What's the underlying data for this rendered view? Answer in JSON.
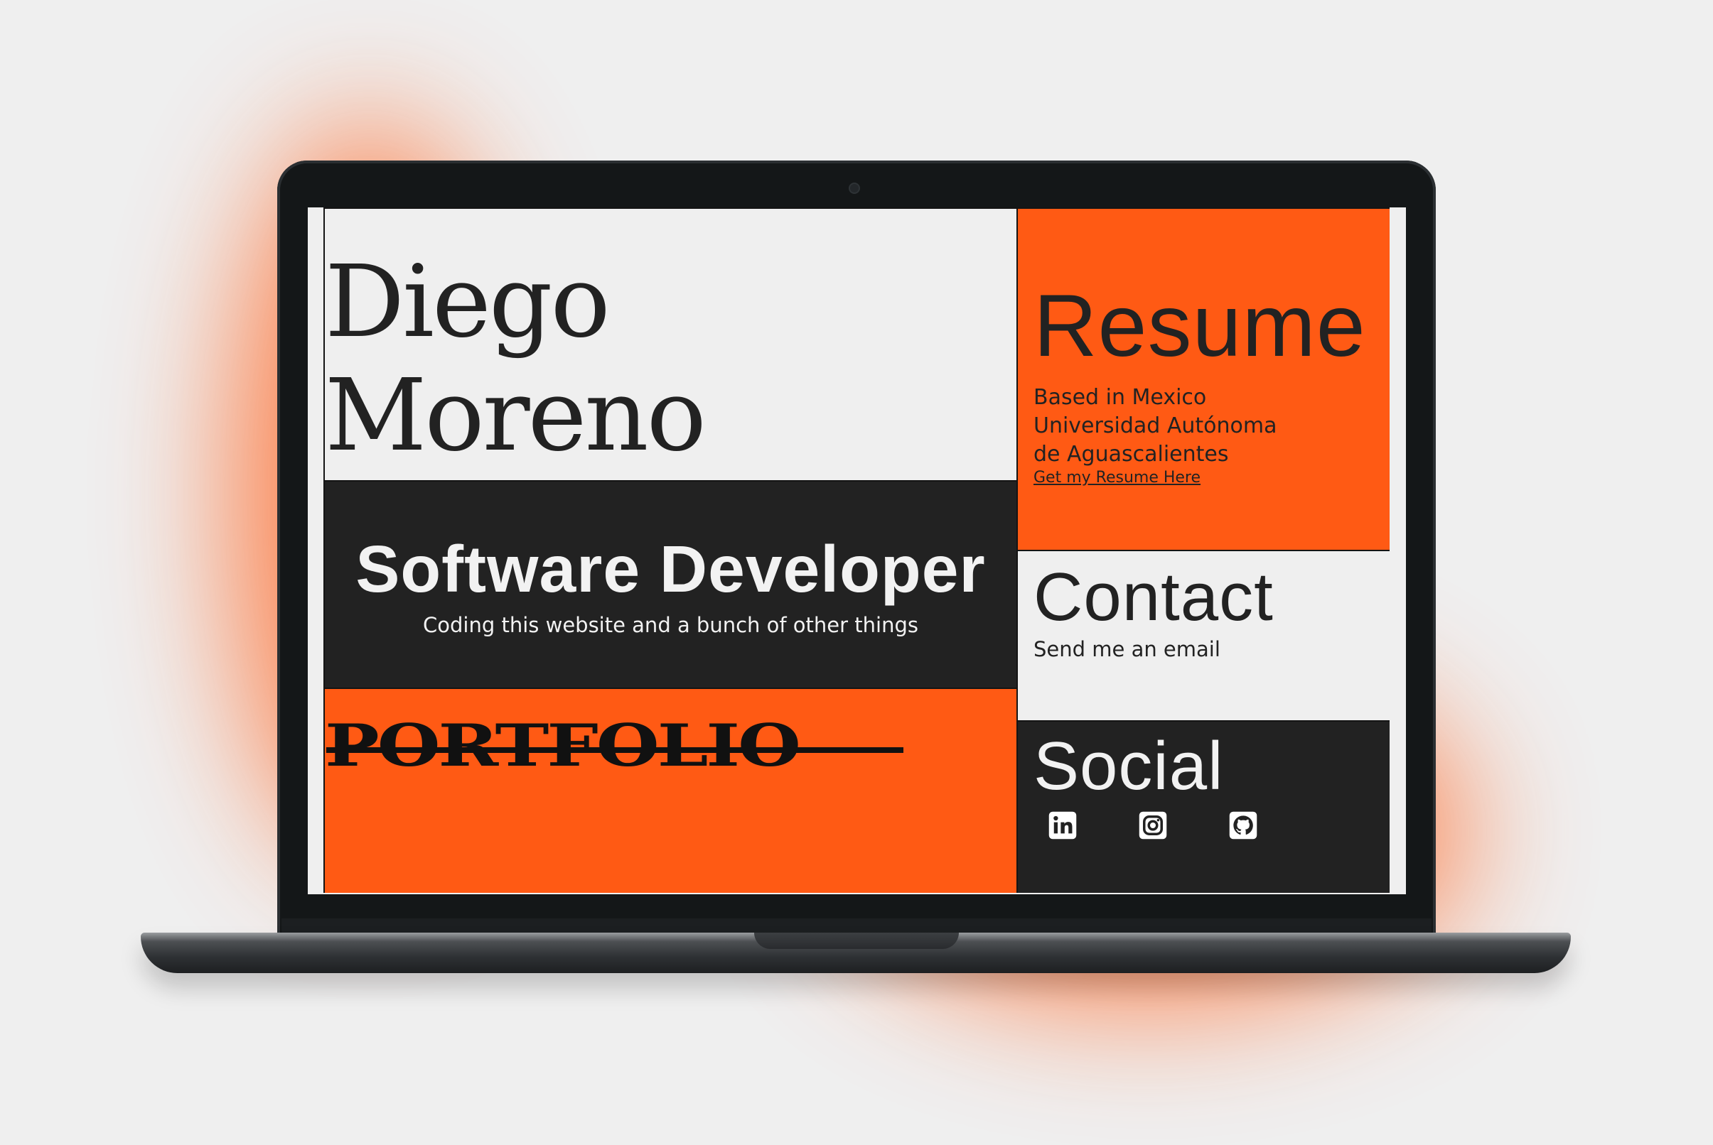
{
  "device": "laptop mockup",
  "colors": {
    "accent": "#ff5a14",
    "dark": "#222222",
    "light": "#efefef"
  },
  "hero": {
    "first_name": "Diego",
    "last_name": "Moreno"
  },
  "role": {
    "title": "Software Developer",
    "subtitle": "Coding this website and a bunch of other things"
  },
  "portfolio": {
    "label": "PORTFOLIO"
  },
  "resume": {
    "title": "Resume",
    "lines": [
      "Based in Mexico",
      "Universidad Autónoma",
      "de Aguascalientes"
    ],
    "link_text": "Get my Resume Here"
  },
  "contact": {
    "title": "Contact",
    "link_text": "Send me an email"
  },
  "social": {
    "title": "Social",
    "icons": [
      "linkedin-icon",
      "instagram-icon",
      "github-icon"
    ]
  }
}
